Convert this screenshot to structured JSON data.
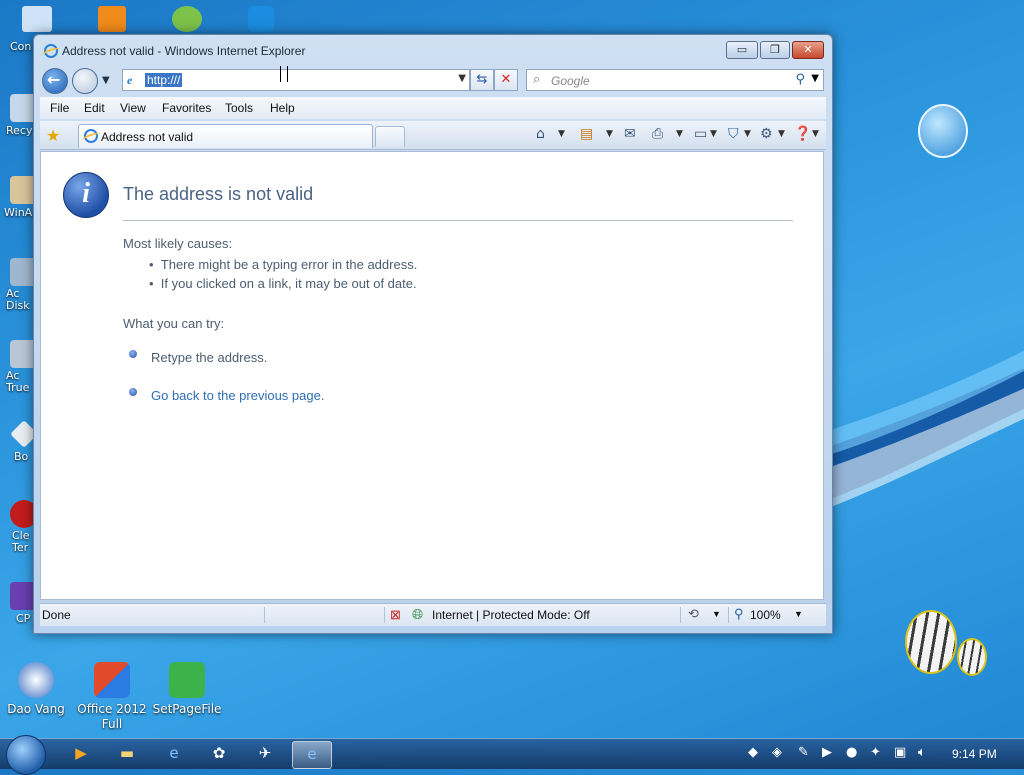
{
  "window": {
    "title": "Address not valid - Windows Internet Explorer",
    "minimize": "▭",
    "maximize": "❐",
    "close": "✕"
  },
  "address_bar": {
    "value": "http:///",
    "search_placeholder": "Google"
  },
  "menu": [
    "File",
    "Edit",
    "View",
    "Favorites",
    "Tools",
    "Help"
  ],
  "tab": {
    "label": "Address not valid"
  },
  "content": {
    "heading": "The address is not valid",
    "causes_label": "Most likely causes:",
    "causes": [
      "There might be a typing error in the address.",
      "If you clicked on a link, it may be out of date."
    ],
    "try_label": "What you can try:",
    "actions": [
      "Retype the address.",
      "Go back to the previous page."
    ]
  },
  "status": {
    "text": "Done",
    "zone": "Internet | Protected Mode: Off",
    "zoom": "100%"
  },
  "desktop": {
    "left_labels": [
      "Con",
      "Recy",
      "WinA",
      "Ac Disk",
      "Ac True",
      "Bo",
      "Cle Ter",
      "CP"
    ],
    "bottom_icons": [
      "Dao Vang",
      "Office 2012 Full",
      "SetPageFile"
    ]
  },
  "taskbar": {
    "clock": "9:14 PM"
  },
  "colors": {
    "accent": "#2f6db5",
    "heading": "#4a6383",
    "desktop": "#2a93dc"
  }
}
